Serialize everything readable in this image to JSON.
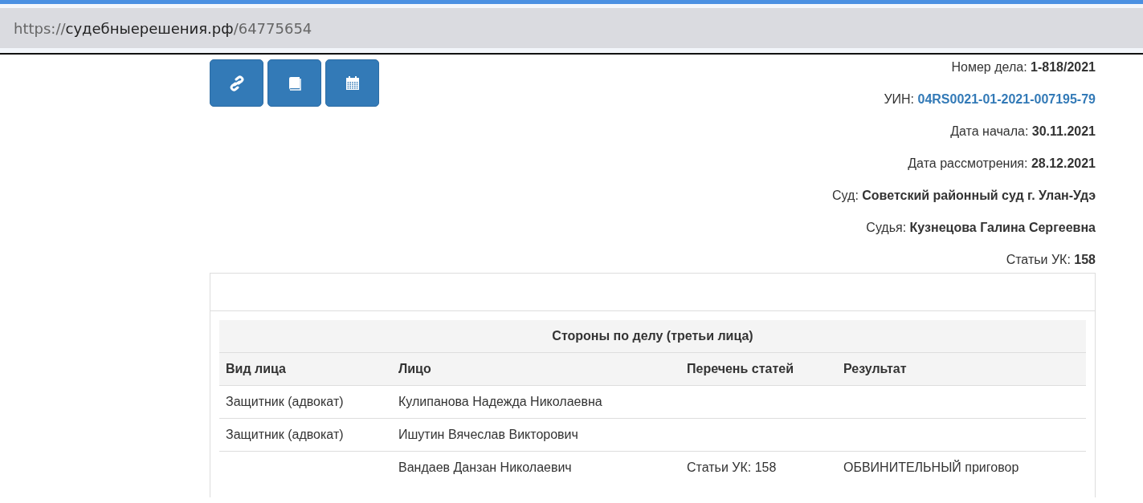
{
  "address_bar": {
    "scheme": "https://",
    "host": "судебныерешения.рф",
    "path": "/64775654"
  },
  "toolbar": [
    {
      "kind": "link"
    },
    {
      "kind": "book"
    },
    {
      "kind": "calendar"
    }
  ],
  "details": [
    {
      "kind": "text",
      "label": "Номер дела:",
      "value": "1-818/2021"
    },
    {
      "kind": "link",
      "label": "УИН:",
      "value": "04RS0021-01-2021-007195-79"
    },
    {
      "kind": "text",
      "label": "Дата начала:",
      "value": "30.11.2021"
    },
    {
      "kind": "text",
      "label": "Дата рассмотрения:",
      "value": "28.12.2021"
    },
    {
      "kind": "text",
      "label": "Суд:",
      "value": "Советский районный суд г. Улан-Удэ"
    },
    {
      "kind": "text",
      "label": "Судья:",
      "value": "Кузнецова Галина Сергеевна"
    },
    {
      "kind": "text",
      "label": "Статьи УК:",
      "value": "158"
    }
  ],
  "table": {
    "title": "Стороны по делу (третьи лица)",
    "columns": [
      "Вид лица",
      "Лицо",
      "Перечень статей",
      "Результат"
    ],
    "rows": [
      [
        "Защитник (адвокат)",
        "Кулипанова Надежда Николаевна",
        "",
        ""
      ],
      [
        "Защитник (адвокат)",
        "Ишутин Вячеслав Викторович",
        "",
        ""
      ],
      [
        "",
        "Вандаев Данзан Николаевич",
        "Статьи УК: 158",
        "ОБВИНИТЕЛЬНЫЙ приговор"
      ]
    ]
  }
}
